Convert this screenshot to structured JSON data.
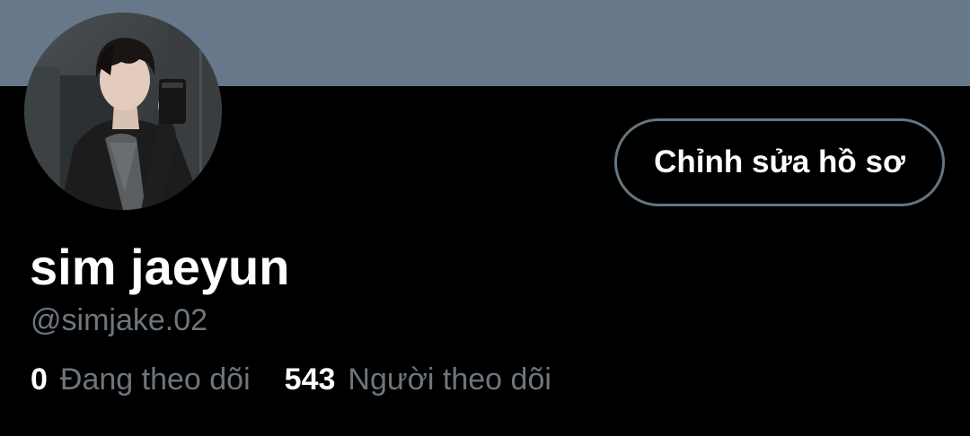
{
  "profile": {
    "banner_color": "#66788a",
    "display_name": "sim jaeyun",
    "handle": "@simjake.02",
    "edit_button_label": "Chỉnh sửa hồ sơ",
    "following_count": "0",
    "following_label": "Đang theo dõi",
    "followers_count": "543",
    "followers_label": "Người theo dõi"
  },
  "colors": {
    "background": "#000000",
    "primary_text": "#ffffff",
    "secondary_text": "#6e767d",
    "button_border": "#66757f"
  }
}
